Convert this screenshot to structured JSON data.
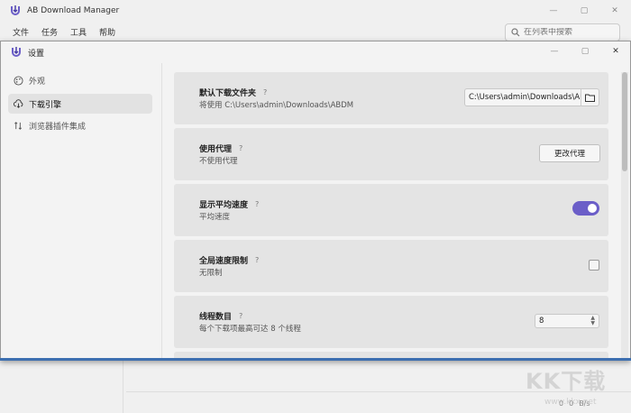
{
  "app": {
    "title": "AB Download Manager",
    "menu": [
      "文件",
      "任务",
      "工具",
      "帮助"
    ],
    "search_placeholder": "在列表中搜索",
    "status": [
      "0",
      "0",
      "B/s"
    ]
  },
  "dialog": {
    "title": "设置",
    "sidebar": [
      {
        "label": "外观",
        "icon": "palette-icon",
        "active": false
      },
      {
        "label": "下载引擎",
        "icon": "cloud-download-icon",
        "active": true
      },
      {
        "label": "浏览器插件集成",
        "icon": "swap-icon",
        "active": false
      }
    ],
    "rows": [
      {
        "title": "默认下载文件夹",
        "help": "?",
        "desc": "将使用 C:\\Users\\admin\\Downloads\\ABDM",
        "control": "path",
        "value": "C:\\Users\\admin\\Downloads\\ABDM"
      },
      {
        "title": "使用代理",
        "help": "?",
        "desc": "不使用代理",
        "control": "button",
        "button_label": "更改代理"
      },
      {
        "title": "显示平均速度",
        "help": "?",
        "desc": "平均速度",
        "control": "toggle",
        "on": true
      },
      {
        "title": "全局速度限制",
        "help": "?",
        "desc": "无限制",
        "control": "checkbox",
        "checked": false
      },
      {
        "title": "线程数目",
        "help": "?",
        "desc": "每个下载项最高可达 8 个线程",
        "control": "spinner",
        "value": "8"
      }
    ]
  },
  "watermark": {
    "text": "KK下载",
    "url": "www.kkx.net"
  },
  "colors": {
    "accent": "#6b5ec8",
    "row_bg": "#e4e4e4",
    "dialog_bg": "#f3f3f3"
  }
}
